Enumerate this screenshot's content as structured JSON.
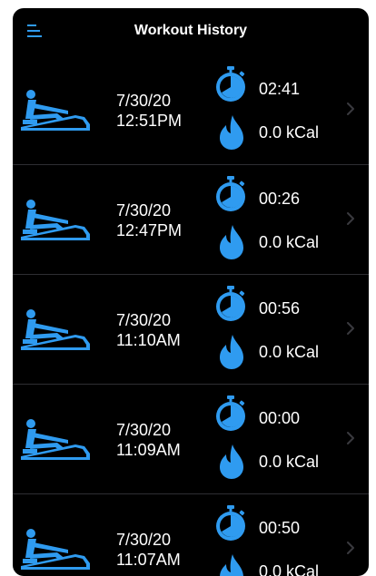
{
  "header": {
    "title": "Workout History",
    "menu_icon": "hamburger-menu-icon"
  },
  "colors": {
    "accent": "#2f9bf0",
    "background": "#000000",
    "text": "#ffffff",
    "divider": "#2e2e33",
    "chevron": "#3a3a3f"
  },
  "workouts": [
    {
      "date": "7/30/20",
      "time": "12:51PM",
      "duration": "02:41",
      "calories": "0.0 kCal"
    },
    {
      "date": "7/30/20",
      "time": "12:47PM",
      "duration": "00:26",
      "calories": "0.0 kCal"
    },
    {
      "date": "7/30/20",
      "time": "11:10AM",
      "duration": "00:56",
      "calories": "0.0 kCal"
    },
    {
      "date": "7/30/20",
      "time": "11:09AM",
      "duration": "00:00",
      "calories": "0.0 kCal"
    },
    {
      "date": "7/30/20",
      "time": "11:07AM",
      "duration": "00:50",
      "calories": "0.0 kCal"
    }
  ]
}
